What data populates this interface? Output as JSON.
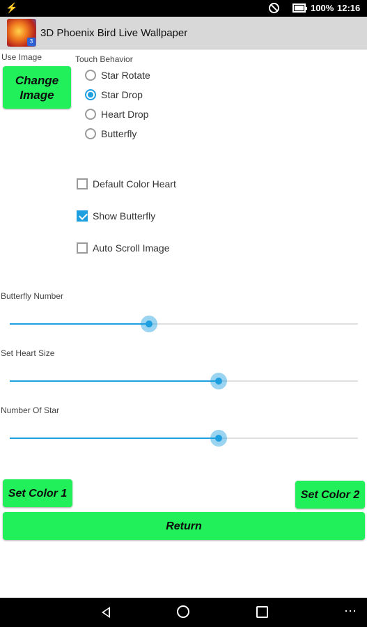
{
  "status_bar": {
    "usb_icon": "usb-icon",
    "battery_percent": "100%",
    "time": "12:16"
  },
  "app_bar": {
    "title": "3D Phoenix Bird Live Wallpaper",
    "icon_badge": "3"
  },
  "use_image": {
    "label": "Use Image",
    "button_label": "Change Image"
  },
  "touch_behavior": {
    "label": "Touch Behavior",
    "options": [
      {
        "label": "Star Rotate",
        "selected": false
      },
      {
        "label": "Star Drop",
        "selected": true
      },
      {
        "label": "Heart Drop",
        "selected": false
      },
      {
        "label": "Butterfly",
        "selected": false
      }
    ]
  },
  "checkboxes": [
    {
      "label": "Default Color Heart",
      "checked": false
    },
    {
      "label": "Show Butterfly",
      "checked": true
    },
    {
      "label": "Auto Scroll Image",
      "checked": false
    }
  ],
  "sliders": [
    {
      "label": "Butterfly Number",
      "value": 0.4
    },
    {
      "label": "Set Heart Size",
      "value": 0.6
    },
    {
      "label": "Number Of Star",
      "value": 0.6
    }
  ],
  "buttons": {
    "set_color_1": "Set Color 1",
    "set_color_2": "Set Color 2",
    "return": "Return"
  },
  "colors": {
    "accent": "#1e9fe0",
    "button_green": "#22f05a"
  }
}
